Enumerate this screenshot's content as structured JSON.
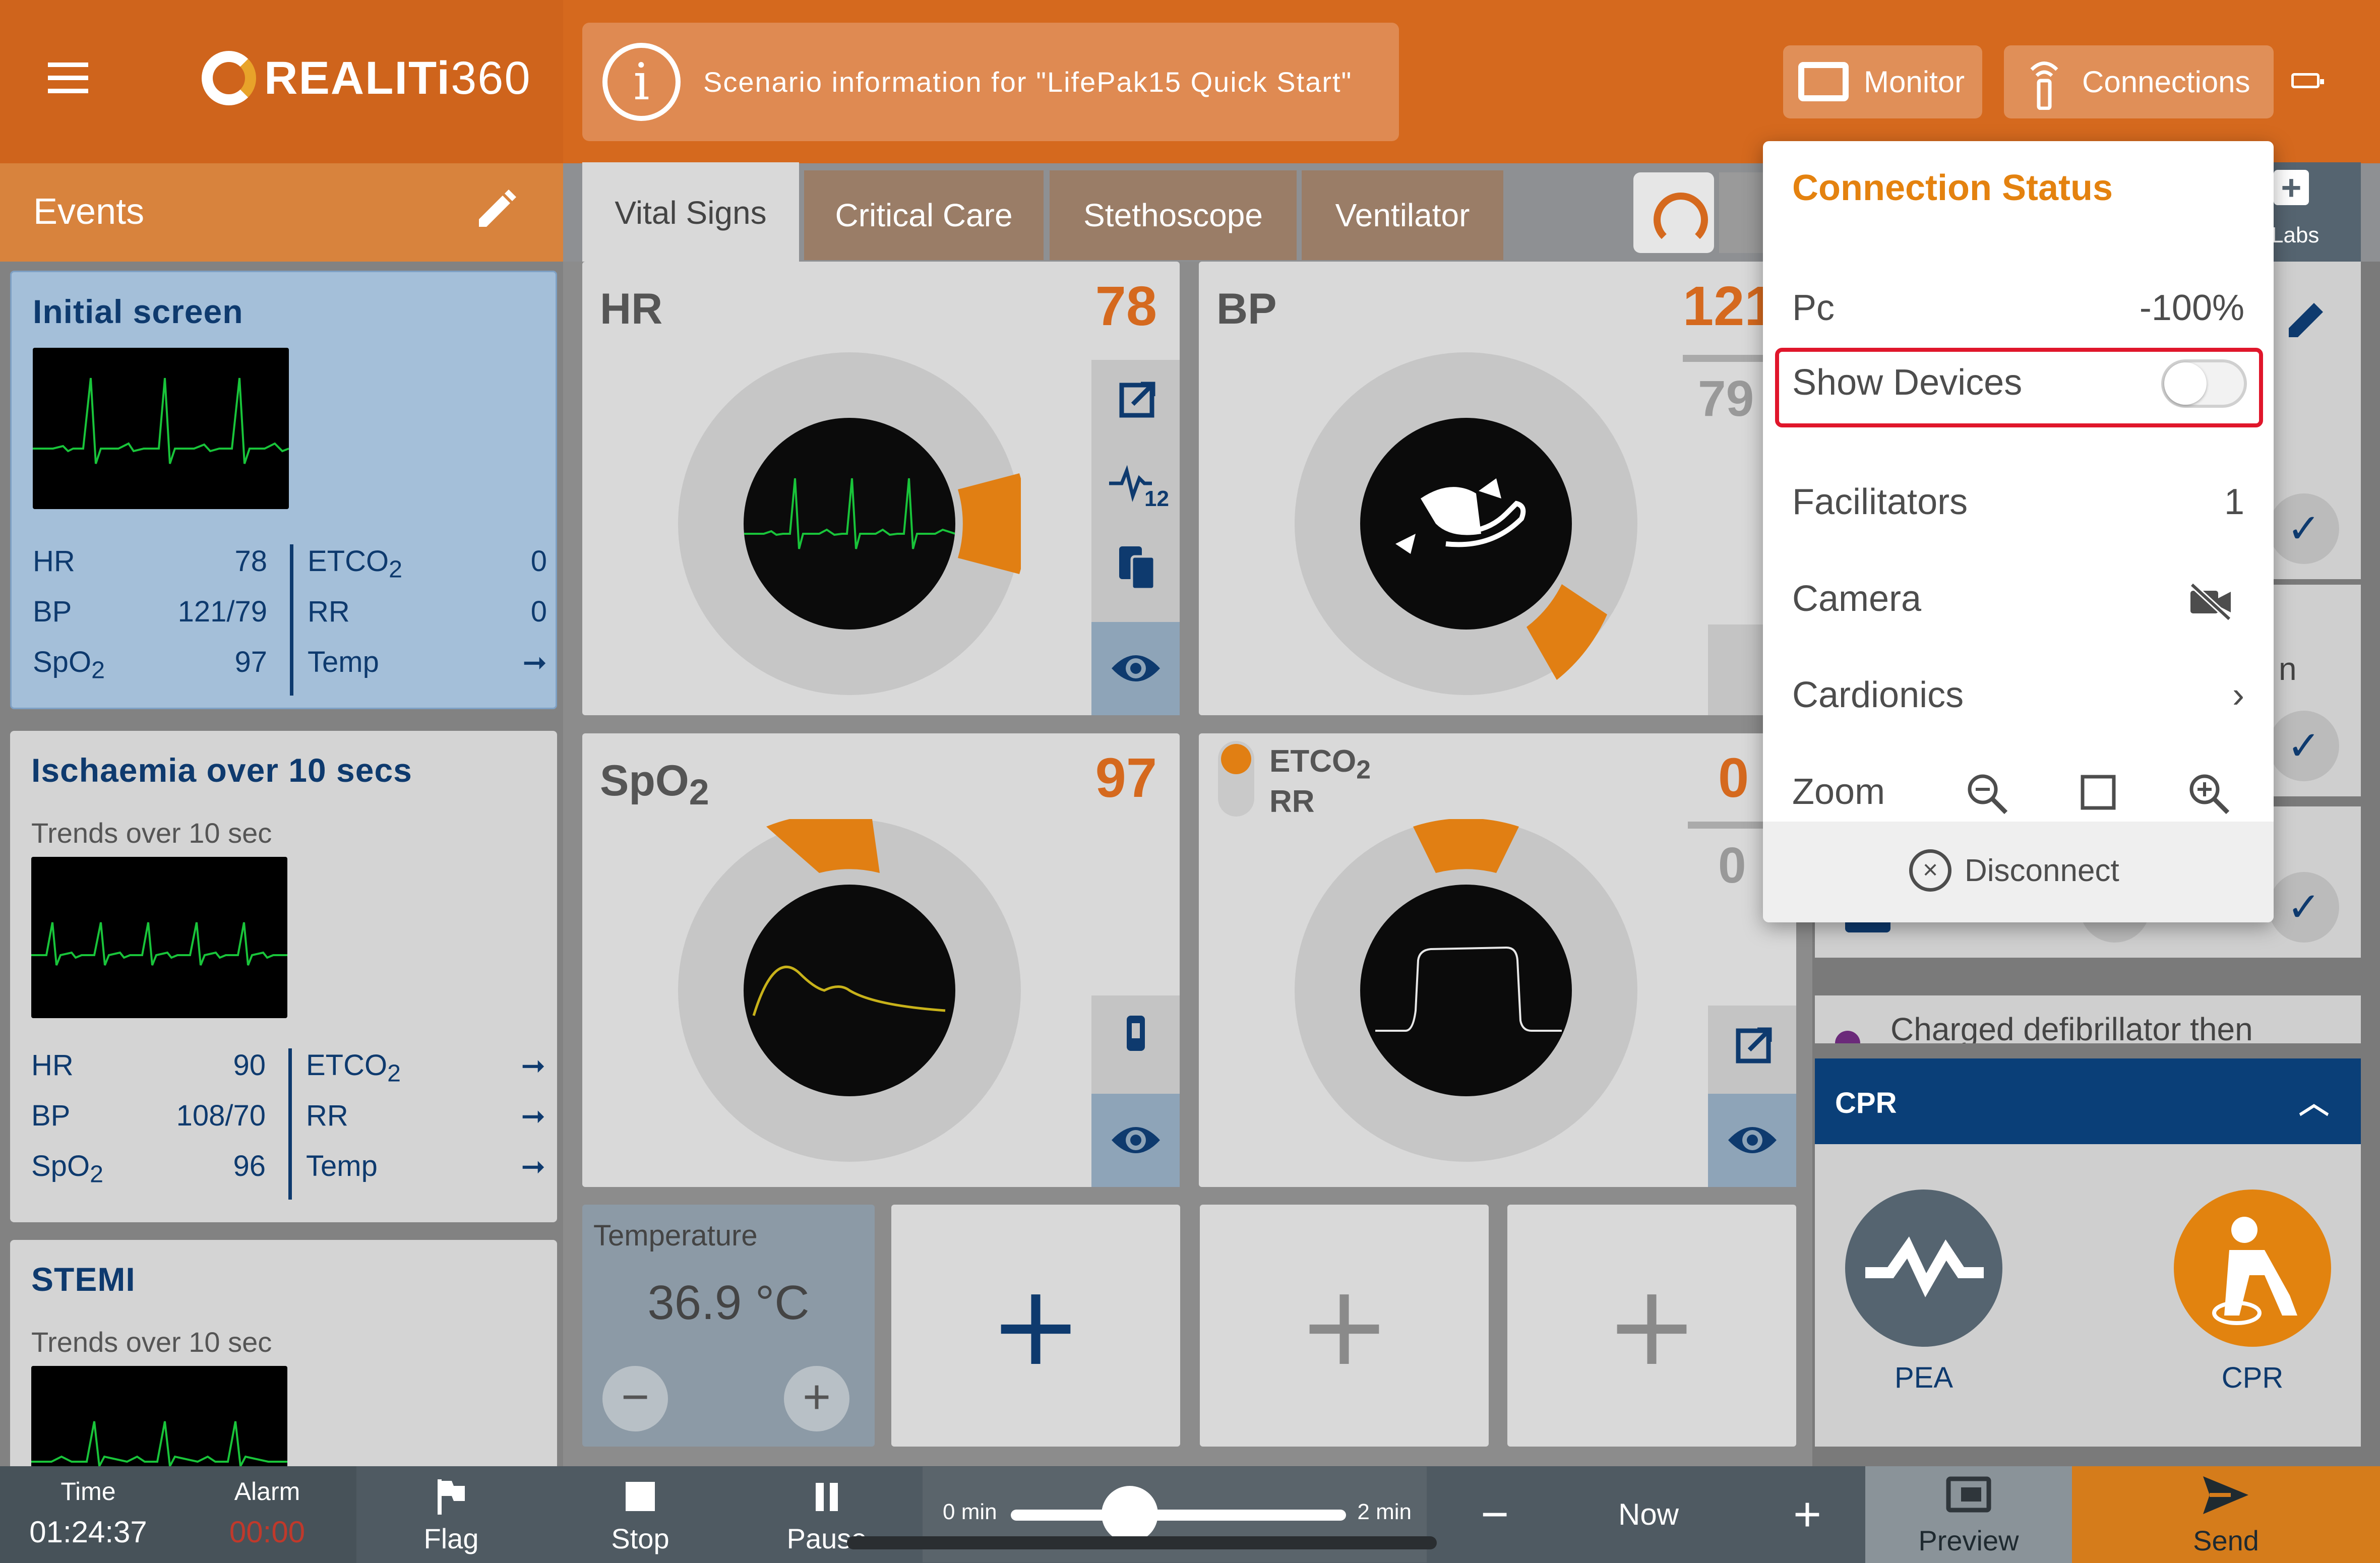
{
  "app": {
    "brand": "REALITi360",
    "brand_bold": "REALITi",
    "brand_light": "360"
  },
  "header": {
    "scenario_info": "Scenario information for  \"LifePak15 Quick Start\"",
    "monitor_label": "Monitor",
    "connections_label": "Connections"
  },
  "events_panel": {
    "title": "Events"
  },
  "events": [
    {
      "title": "Initial screen",
      "subtitle": "",
      "hr": "78",
      "bp": "121/79",
      "spo2": "97",
      "etco2": "0",
      "rr": "0",
      "temp": "➞"
    },
    {
      "title": "Ischaemia over 10 secs",
      "subtitle": "Trends over 10 sec",
      "hr": "90",
      "bp": "108/70",
      "spo2": "96",
      "etco2": "➞",
      "rr": "➞",
      "temp": "➞"
    },
    {
      "title": "STEMI",
      "subtitle": "Trends over 10 sec"
    }
  ],
  "vital_labels": {
    "hr": "HR",
    "bp": "BP",
    "spo2": "SpO",
    "spo2_sub": "2",
    "etco2": "ETCO",
    "etco2_sub": "2",
    "rr": "RR",
    "temp": "Temp"
  },
  "tabs": [
    "Vital Signs",
    "Critical Care",
    "Stethoscope",
    "Ventilator"
  ],
  "tiles": {
    "hr": {
      "label": "HR",
      "value": "78"
    },
    "bp": {
      "label": "BP",
      "value_sys": "121",
      "value_dia": "79"
    },
    "spo2": {
      "label": "SpO",
      "sub": "2",
      "value": "97"
    },
    "etco2": {
      "label": "ETCO",
      "sub": "2",
      "label2": "RR",
      "value": "0",
      "value2": "0"
    },
    "temperature": {
      "label": "Temperature",
      "value": "36.9 °C"
    }
  },
  "right_panel": {
    "labs_label": "Labs",
    "partial_text_1": "n",
    "log_text": "Charged defibrillator then",
    "cpr_section": "CPR",
    "buttons": [
      {
        "label": "PEA"
      },
      {
        "label": "CPR"
      }
    ]
  },
  "connection_status": {
    "title": "Connection Status",
    "pc_label": "Pc",
    "pc_value": "-100%",
    "show_devices_label": "Show Devices",
    "show_devices_on": false,
    "facilitators_label": "Facilitators",
    "facilitators_value": "1",
    "camera_label": "Camera",
    "cardionics_label": "Cardionics",
    "zoom_label": "Zoom",
    "disconnect_label": "Disconnect"
  },
  "bottom": {
    "time_label": "Time",
    "time_value": "01:24:37",
    "alarm_label": "Alarm",
    "alarm_value": "00:00",
    "flag_label": "Flag",
    "stop_label": "Stop",
    "pause_label": "Pause",
    "slider_min": "0 min",
    "slider_max": "2 min",
    "now_label": "Now",
    "preview_label": "Preview",
    "send_label": "Send"
  },
  "colors": {
    "brand_orange": "#d5691e",
    "navy": "#0e3a6e",
    "highlight_red": "#e0162b",
    "ecg_green": "#19c43a",
    "spo2_yellow": "#c8b21a"
  }
}
